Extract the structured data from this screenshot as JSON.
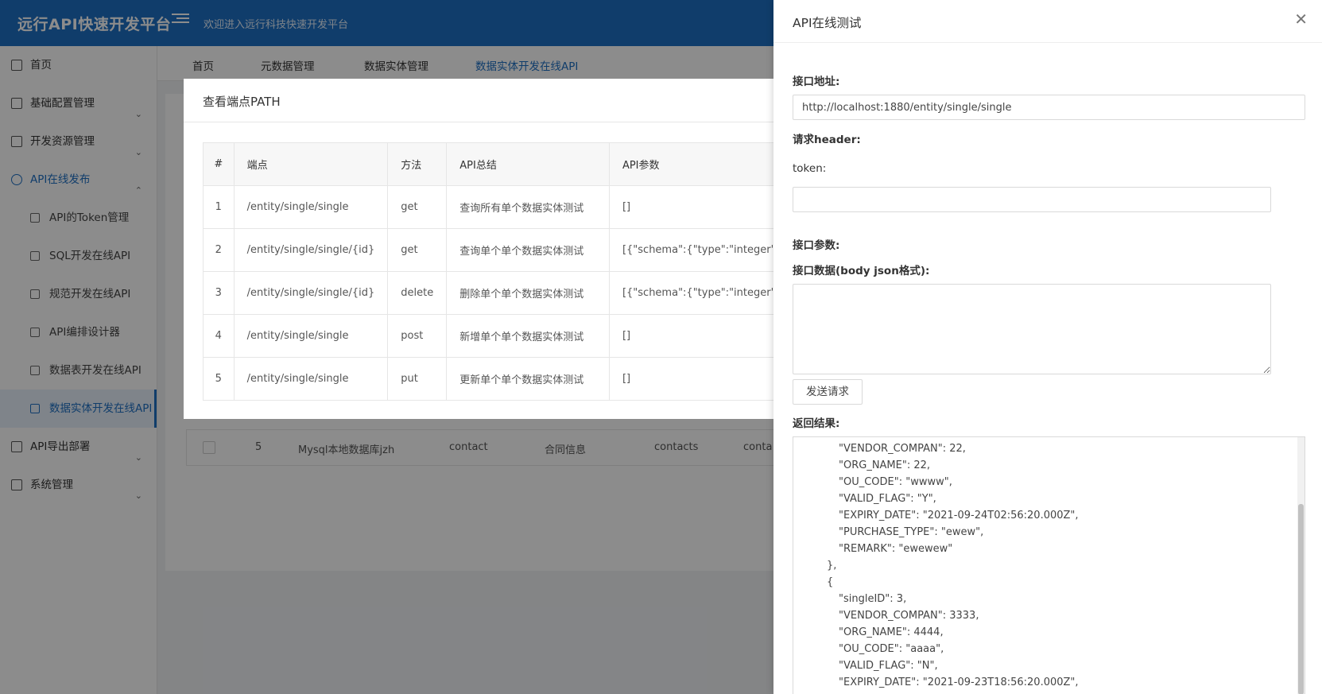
{
  "header": {
    "brand": "远行API快速开发平台",
    "welcome": "欢迎进入远行科技快速开发平台"
  },
  "sidebar": {
    "items": [
      {
        "label": "首页",
        "icon": "home-icon"
      },
      {
        "label": "基础配置管理",
        "icon": "wrench-icon"
      },
      {
        "label": "开发资源管理",
        "icon": "list-icon"
      },
      {
        "label": "API在线发布",
        "icon": "cloud-icon"
      },
      {
        "label": "API导出部署",
        "icon": "export-icon"
      },
      {
        "label": "系统管理",
        "icon": "gear-icon"
      }
    ],
    "sub_items": [
      {
        "label": "API的Token管理",
        "icon": "key-icon"
      },
      {
        "label": "SQL开发在线API",
        "icon": "fork-icon"
      },
      {
        "label": "规范开发在线API",
        "icon": "doc-icon"
      },
      {
        "label": "API编排设计器",
        "icon": "layout-icon"
      },
      {
        "label": "数据表开发在线API",
        "icon": "table-icon"
      },
      {
        "label": "数据实体开发在线API",
        "icon": "file-icon"
      }
    ]
  },
  "tabs": [
    "首页",
    "元数据管理",
    "数据实体管理",
    "数据实体开发在线API"
  ],
  "background_row": {
    "index": "5",
    "db": "Mysql本地数据库jzh",
    "table": "contact",
    "name": "合同信息",
    "entity": "contacts",
    "extra": "conta"
  },
  "modal": {
    "title": "查看端点PATH",
    "columns": [
      "#",
      "端点",
      "方法",
      "API总结",
      "API参数"
    ],
    "rows": [
      {
        "num": "1",
        "path": "/entity/single/single",
        "method": "get",
        "summary": "查询所有单个数据实体测试",
        "params": "[]"
      },
      {
        "num": "2",
        "path": "/entity/single/single/{id}",
        "method": "get",
        "summary": "查询单个单个数据实体测试",
        "params": "[{\"schema\":{\"type\":\"integer\"},\""
      },
      {
        "num": "3",
        "path": "/entity/single/single/{id}",
        "method": "delete",
        "summary": "删除单个单个数据实体测试",
        "params": "[{\"schema\":{\"type\":\"integer\"},\""
      },
      {
        "num": "4",
        "path": "/entity/single/single",
        "method": "post",
        "summary": "新增单个单个数据实体测试",
        "params": "[]"
      },
      {
        "num": "5",
        "path": "/entity/single/single",
        "method": "put",
        "summary": "更新单个单个数据实体测试",
        "params": "[]"
      }
    ]
  },
  "drawer": {
    "title": "API在线测试",
    "url_label": "接口地址:",
    "url_value": "http://localhost:1880/entity/single/single",
    "header_label": "请求header:",
    "token_label": "token:",
    "token_value": "",
    "params_label": "接口参数:",
    "body_label": "接口数据(body json格式):",
    "body_value": "",
    "send_label": "发送请求",
    "result_label": "返回结果:",
    "result_lines": [
      "\"VENDOR_COMPAN\": 22,",
      "\"ORG_NAME\": 22,",
      "\"OU_CODE\": \"wwww\",",
      "\"VALID_FLAG\": \"Y\",",
      "\"EXPIRY_DATE\": \"2021-09-24T02:56:20.000Z\",",
      "\"PURCHASE_TYPE\": \"ewew\",",
      "\"REMARK\": \"ewewew\"",
      "},",
      "{",
      "\"singleID\": 3,",
      "\"VENDOR_COMPAN\": 3333,",
      "\"ORG_NAME\": 4444,",
      "\"OU_CODE\": \"aaaa\",",
      "\"VALID_FLAG\": \"N\",",
      "\"EXPIRY_DATE\": \"2021-09-23T18:56:20.000Z\","
    ]
  }
}
